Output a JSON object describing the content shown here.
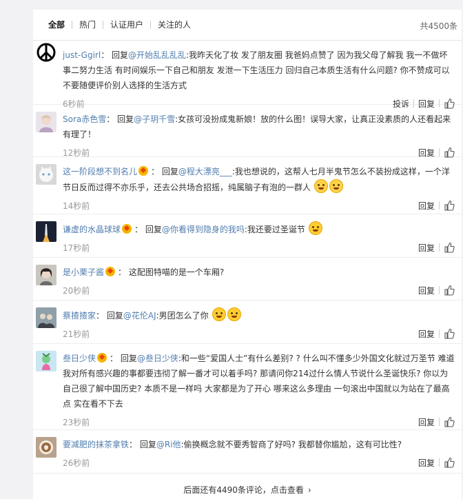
{
  "tabs": [
    {
      "label": "全部"
    },
    {
      "label": "热门"
    },
    {
      "label": "认证用户"
    },
    {
      "label": "关注的人"
    }
  ],
  "total": "共4500条",
  "reply_word": "回复",
  "comments": [
    {
      "user": "just-Ggirl",
      "sep": "：",
      "prefix": "回复",
      "mention": "@开始乱乱乱乱",
      "text": ":我昨天化了妆 发了朋友圈 我爸妈点赞了 因为我父母了解我 我一不做坏事二努力生活 有时间娱乐一下自己和朋友 发泄一下生活压力 回归自己本质生活有什么问题? 你不赞成可以 不要随便评价别人选择的生活方式",
      "time": "6秒前",
      "report": "投诉",
      "reply": "回复"
    },
    {
      "user": "Sora赤色雪",
      "sep": "：",
      "prefix": "回复",
      "mention": "@子玥千雪",
      "text": ":女孩可没扮成鬼新娘！放的什么图！误导大家，让真正没素质的人还看起来有理了！",
      "time": "12秒前",
      "reply": "回复"
    },
    {
      "user": "这一阶段想不到名儿",
      "sep": "：",
      "prefix": "回复",
      "mention": "@程大漂亮___",
      "text": ":我也想说的，这帮人七月半鬼节怎么不装扮成这样，一个洋节日反而过得不亦乐乎，还去公共场合招摇，纯属脑子有泡的一群人",
      "time": "14秒前",
      "reply": "回复"
    },
    {
      "user": "谦虚的水晶球球",
      "sep": "：",
      "prefix": "回复",
      "mention": "@你看得到隐身的我吗",
      "text": ":我还要过圣诞节",
      "time": "17秒前",
      "reply": "回复"
    },
    {
      "user": "是小栗子酱",
      "sep": "：",
      "text": "这配图特喵的是一个车厢?",
      "time": "20秒前",
      "reply": "回复"
    },
    {
      "user": "蔡揸揸家",
      "sep": "：",
      "prefix": "回复",
      "mention": "@花伦AJ",
      "text": ":男团怎么了你",
      "time": "21秒前",
      "reply": "回复"
    },
    {
      "user": "叁日少侠",
      "sep": "：",
      "prefix": "回复",
      "mention": "@叁日少侠",
      "text": ":和一些“爱国人士”有什么差别? ? 什么叫不懂多少外国文化就过万圣节 难道我对所有感兴趣的事都要违彻了解一番才可以着手吗? 那请问你214过什么情人节说什么圣诞快乐? 你以为自己很了解中国历史? 本质不是一样吗 大家都是为了开心 哪来这么多理由 一句滚出中国就以为站在了最高点 实在看不下去",
      "time": "23秒前",
      "reply": "回复"
    },
    {
      "user": "要减肥的抹茶拿铁",
      "sep": "：",
      "prefix": "回复",
      "mention": "@Ri他",
      "text": ":偷换概念就不要秀智商了好吗? 我都替你尴尬，这有可比性?",
      "time": "26秒前",
      "reply": "回复"
    }
  ],
  "footer": "后面还有4490条评论，点击查看",
  "colors": {
    "link": "#507daf",
    "time": "#999999",
    "bg": "#f2f2f5"
  }
}
